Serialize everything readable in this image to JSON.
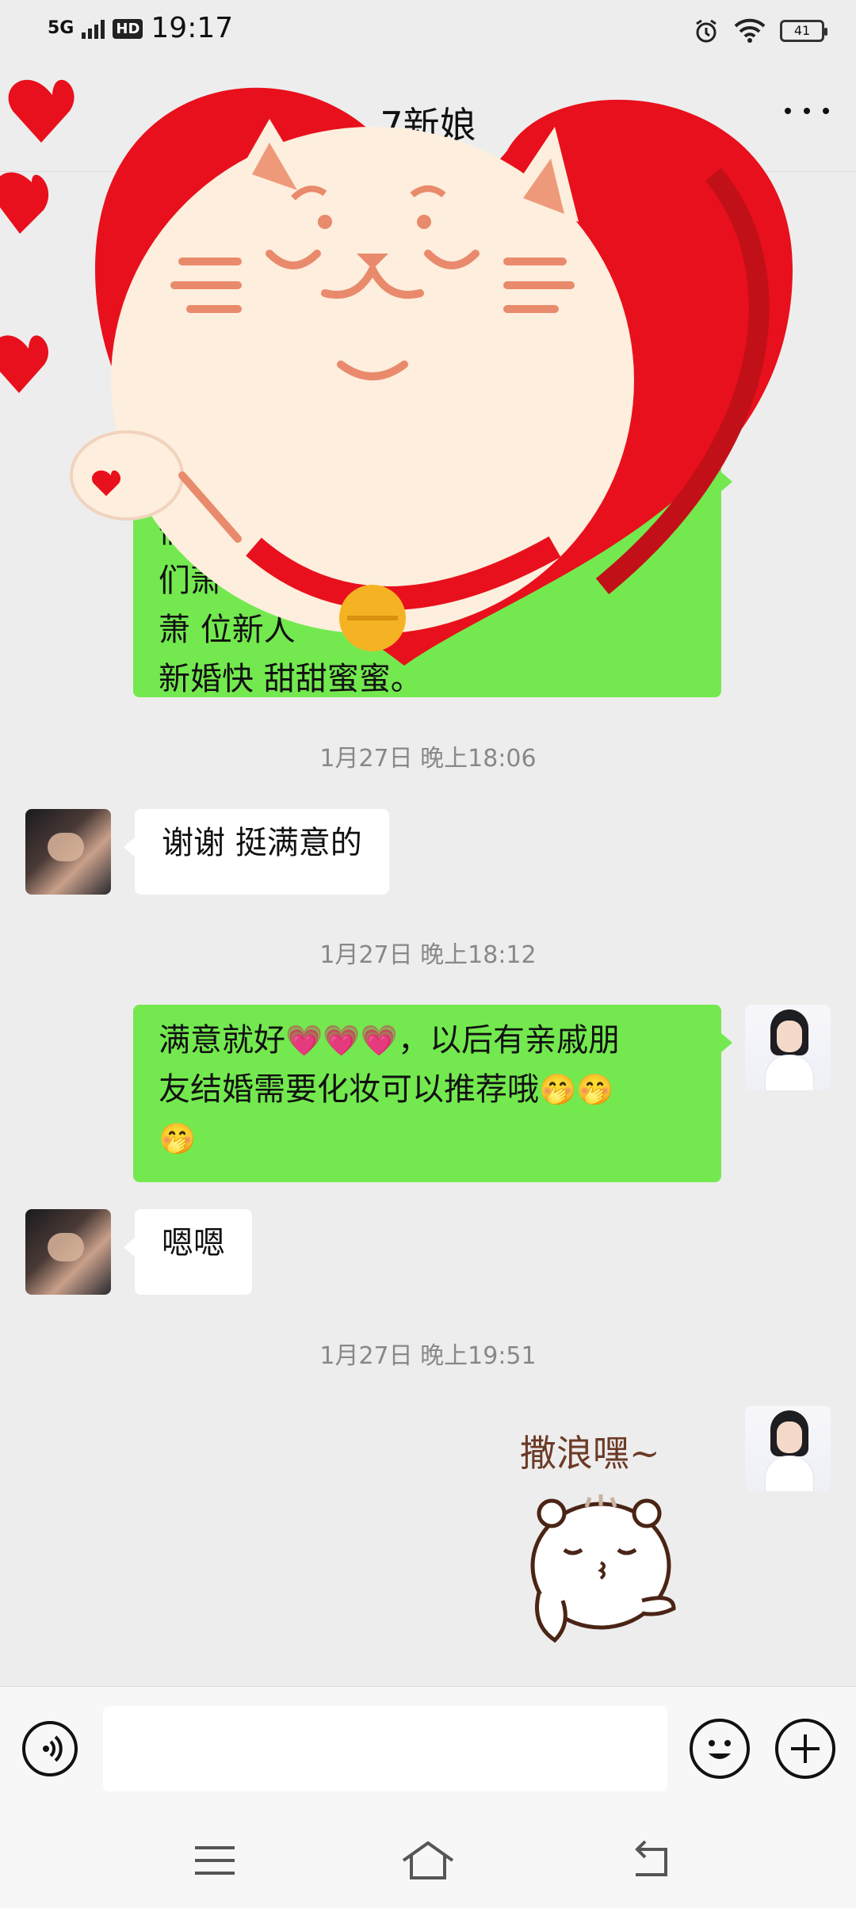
{
  "status_bar": {
    "network": "5G",
    "hd": "HD",
    "time": "19:17",
    "battery": "41"
  },
  "header": {
    "title": "7新娘"
  },
  "messages": [
    {
      "side": "out",
      "text": "们，\n们萧\n萧 位新人\n新婚快 甜甜蜜蜜。"
    },
    {
      "timestamp": "1月27日 晚上18:06"
    },
    {
      "side": "in",
      "text": "谢谢 挺满意的"
    },
    {
      "timestamp": "1月27日 晚上18:12"
    },
    {
      "side": "out",
      "text_a": "满意就好",
      "text_b": "，以后有亲戚朋",
      "text_c": "友结婚需要化妆可以推荐哦"
    },
    {
      "side": "in",
      "text": "嗯嗯"
    },
    {
      "timestamp": "1月27日 晚上19:51"
    },
    {
      "side": "out",
      "sticker_caption": "撒浪嘿~"
    }
  ],
  "input": {
    "placeholder": ""
  },
  "icons": {
    "heart": "heart-emoji",
    "shy": "shy-face-emoji"
  },
  "colors": {
    "outgoing_bubble": "#73e94f",
    "incoming_bubble": "#ffffff",
    "background": "#ededed"
  }
}
